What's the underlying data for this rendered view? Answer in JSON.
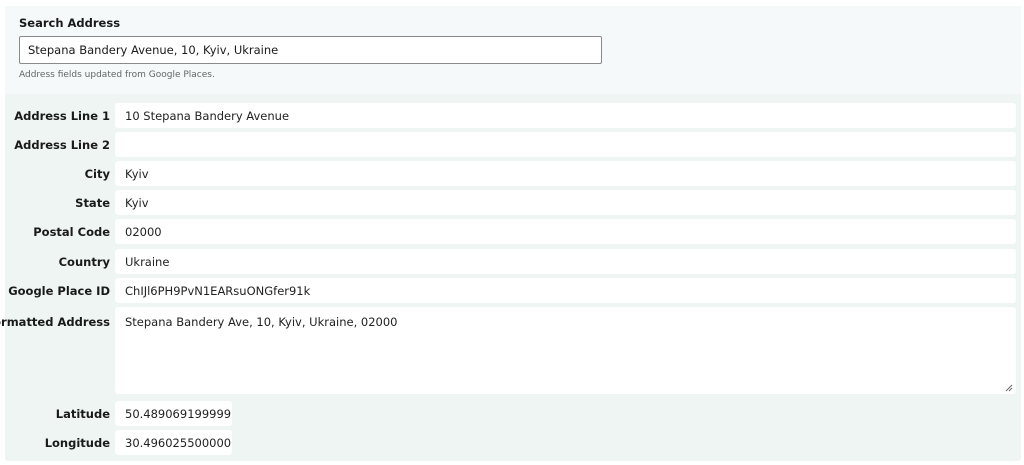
{
  "search": {
    "label": "Search Address",
    "value": "Stepana Bandery Avenue, 10, Kyiv, Ukraine",
    "help": "Address fields updated from Google Places."
  },
  "fields": {
    "address_line_1": {
      "label": "Address Line 1",
      "value": "10 Stepana Bandery Avenue"
    },
    "address_line_2": {
      "label": "Address Line 2",
      "value": ""
    },
    "city": {
      "label": "City",
      "value": "Kyiv"
    },
    "state": {
      "label": "State",
      "value": "Kyiv"
    },
    "postal_code": {
      "label": "Postal Code",
      "value": "02000"
    },
    "country": {
      "label": "Country",
      "value": "Ukraine"
    },
    "google_place_id": {
      "label": "Google Place ID",
      "value": "ChIJl6PH9PvN1EARsuONGfer91k"
    },
    "formatted_address": {
      "label": "Formatted Address",
      "value": "Stepana Bandery Ave, 10, Kyiv, Ukraine, 02000"
    },
    "latitude": {
      "label": "Latitude",
      "value": "50.489069199999"
    },
    "longitude": {
      "label": "Longitude",
      "value": "30.496025500000"
    }
  },
  "colors": {
    "panel_background": "#eef5f3",
    "search_background": "#f5f9f9",
    "field_background": "#ffffff"
  },
  "icons": {
    "textarea_resize": "resize-grip-icon"
  }
}
